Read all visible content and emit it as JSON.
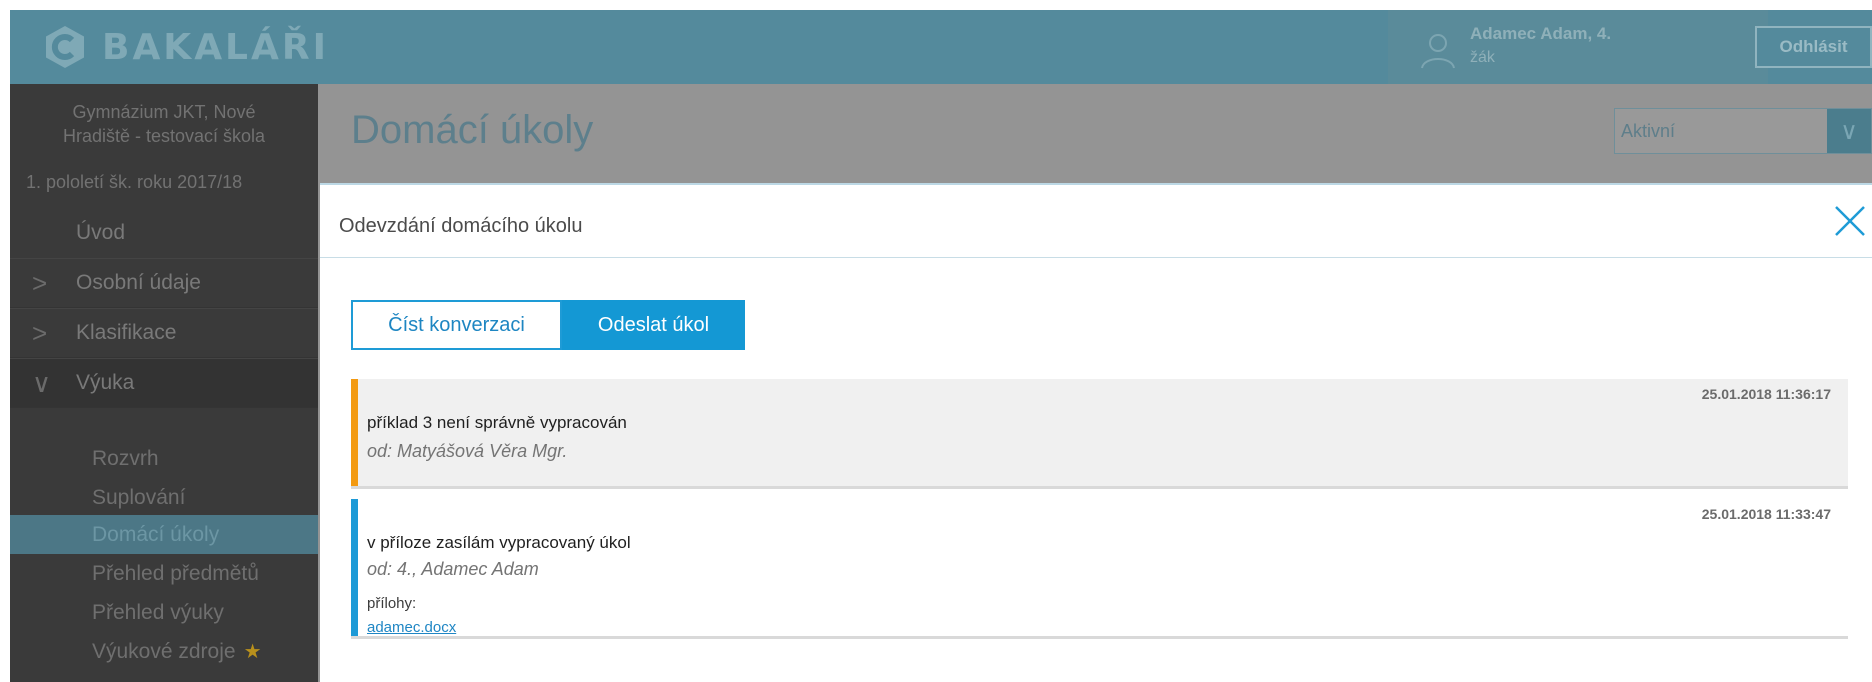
{
  "header": {
    "logo_text": "BAKALÁŘI",
    "user_name": "Adamec Adam, 4.",
    "user_role": "žák",
    "logout_label": "Odhlásit"
  },
  "sidebar": {
    "school_line1": "Gymnázium JKT, Nové",
    "school_line2": "Hradiště - testovací škola",
    "semester": "1. pololetí šk. roku 2017/18",
    "items": [
      {
        "label": "Úvod"
      },
      {
        "label": "Osobní údaje",
        "chevron": ">"
      },
      {
        "label": "Klasifikace",
        "chevron": ">"
      },
      {
        "label": "Výuka",
        "chevron": "∨"
      }
    ],
    "sub_items": [
      {
        "label": "Rozvrh"
      },
      {
        "label": "Suplování"
      },
      {
        "label": "Domácí úkoly",
        "active": true
      },
      {
        "label": "Přehled předmětů"
      },
      {
        "label": "Přehled výuky"
      },
      {
        "label": "Výukové zdroje"
      }
    ]
  },
  "page": {
    "title": "Domácí úkoly",
    "filter_value": "Aktivní"
  },
  "modal": {
    "title": "Odevzdání domácího úkolu",
    "tabs": [
      {
        "label": "Číst konverzaci",
        "selected": false
      },
      {
        "label": "Odeslat úkol",
        "selected": true
      }
    ],
    "messages": [
      {
        "timestamp": "25.01.2018 11:36:17",
        "text": "příklad 3 není správně vypracován",
        "from": "od: Matyášová Věra Mgr."
      },
      {
        "timestamp": "25.01.2018 11:33:47",
        "text": "v příloze zasílám vypracovaný úkol",
        "from": "od: 4., Adamec Adam",
        "attachments_label": "přílohy:",
        "attachment": "adamec.docx"
      }
    ]
  },
  "colors": {
    "header_bg": "#548a9c",
    "sidebar_bg": "#3a3a3a",
    "accent_blue": "#1498d4",
    "accent_orange": "#f39a11"
  },
  "icons": {
    "logo": "bakalari-hex-logo",
    "user": "user-avatar-icon",
    "close": "close-icon",
    "star": "star-icon"
  }
}
